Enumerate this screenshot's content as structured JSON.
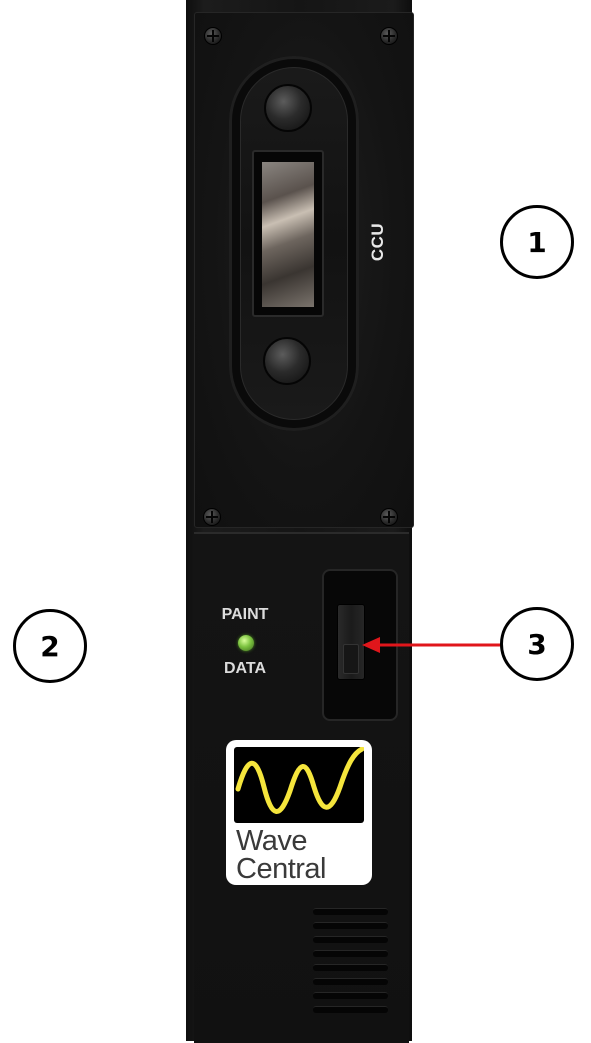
{
  "device": {
    "ccu_label": "CCU",
    "paint_label": "PAINT",
    "data_label": "DATA",
    "led_color": "#7bc23f"
  },
  "logo": {
    "line1": "Wave",
    "line2": "Central",
    "wave_color": "#f5e53c"
  },
  "callouts": {
    "c1": "1",
    "c2": "2",
    "c3": "3"
  },
  "arrow_color": "#e0161b"
}
